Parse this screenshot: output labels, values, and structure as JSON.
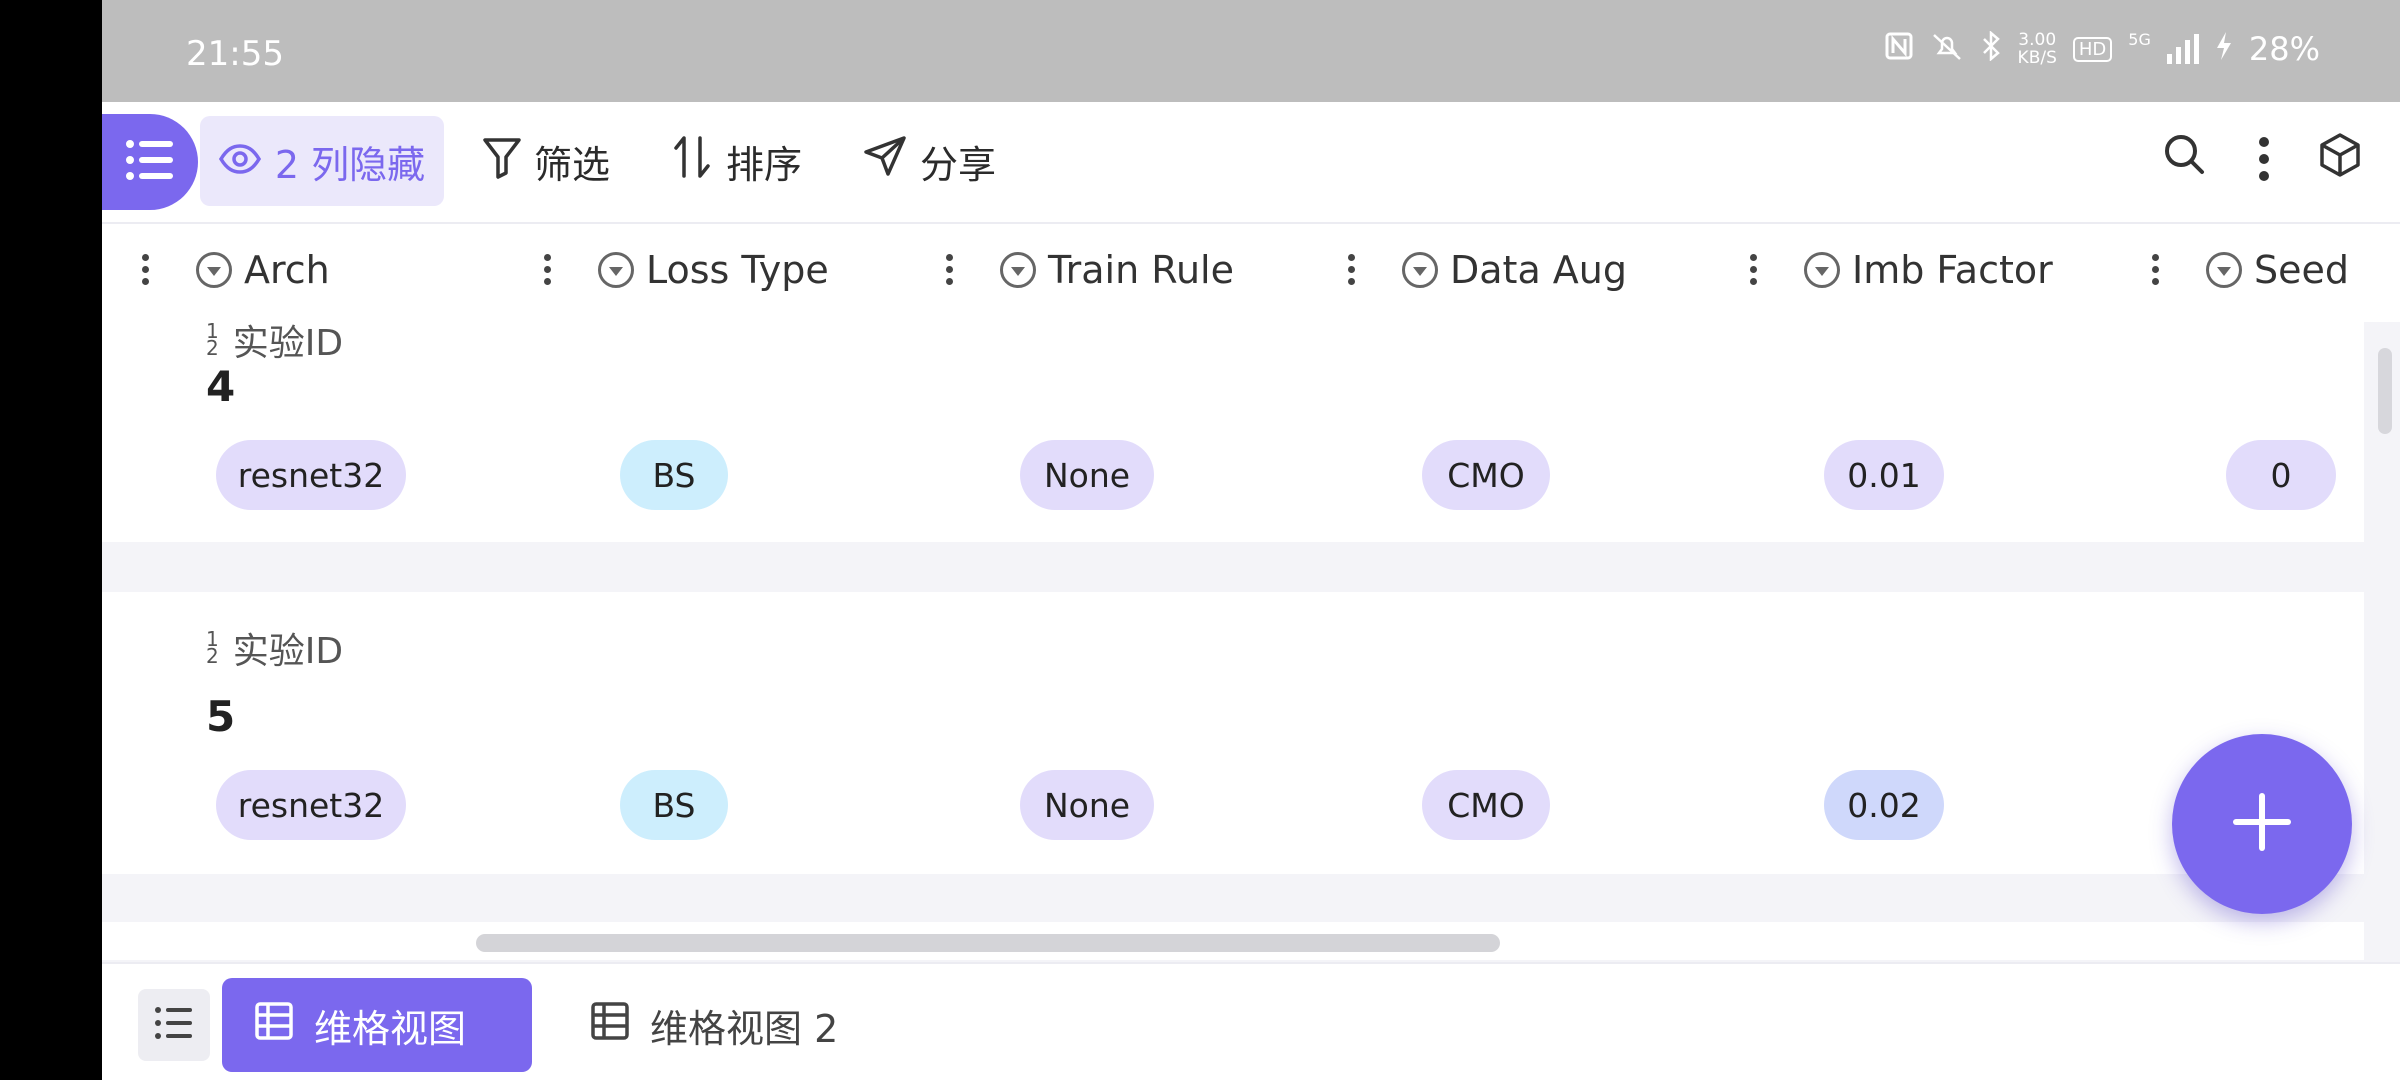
{
  "status_bar": {
    "time": "21:55",
    "net_speed_value": "3.00",
    "net_speed_unit": "KB/S",
    "hd": "HD",
    "network": "5G",
    "battery": "28%"
  },
  "toolbar": {
    "hidden_columns_label": "2 列隐藏",
    "filter_label": "筛选",
    "sort_label": "排序",
    "share_label": "分享"
  },
  "columns": [
    "Arch",
    "Loss Type",
    "Train Rule",
    "Data Aug",
    "Imb Factor",
    "Seed"
  ],
  "records": [
    {
      "field_label": "实验ID",
      "id": "4",
      "cells": [
        "resnet32",
        "BS",
        "None",
        "CMO",
        "0.01",
        "0"
      ]
    },
    {
      "field_label": "实验ID",
      "id": "5",
      "cells": [
        "resnet32",
        "BS",
        "None",
        "CMO",
        "0.02"
      ]
    }
  ],
  "bottom_bar": {
    "views": [
      {
        "label": "维格视图",
        "active": true
      },
      {
        "label": "维格视图 2",
        "active": false
      }
    ]
  },
  "colors": {
    "accent": "#7b68ee",
    "pill_purple": "#e2dcfb",
    "pill_blue": "#cdeefd",
    "pill_indigo": "#cfd8fb"
  },
  "icons": [
    "list-menu-icon",
    "eye-icon",
    "filter-icon",
    "sort-icon",
    "share-icon",
    "search-icon",
    "more-vertical-icon",
    "cube-icon",
    "plus-icon",
    "grid-view-icon"
  ]
}
